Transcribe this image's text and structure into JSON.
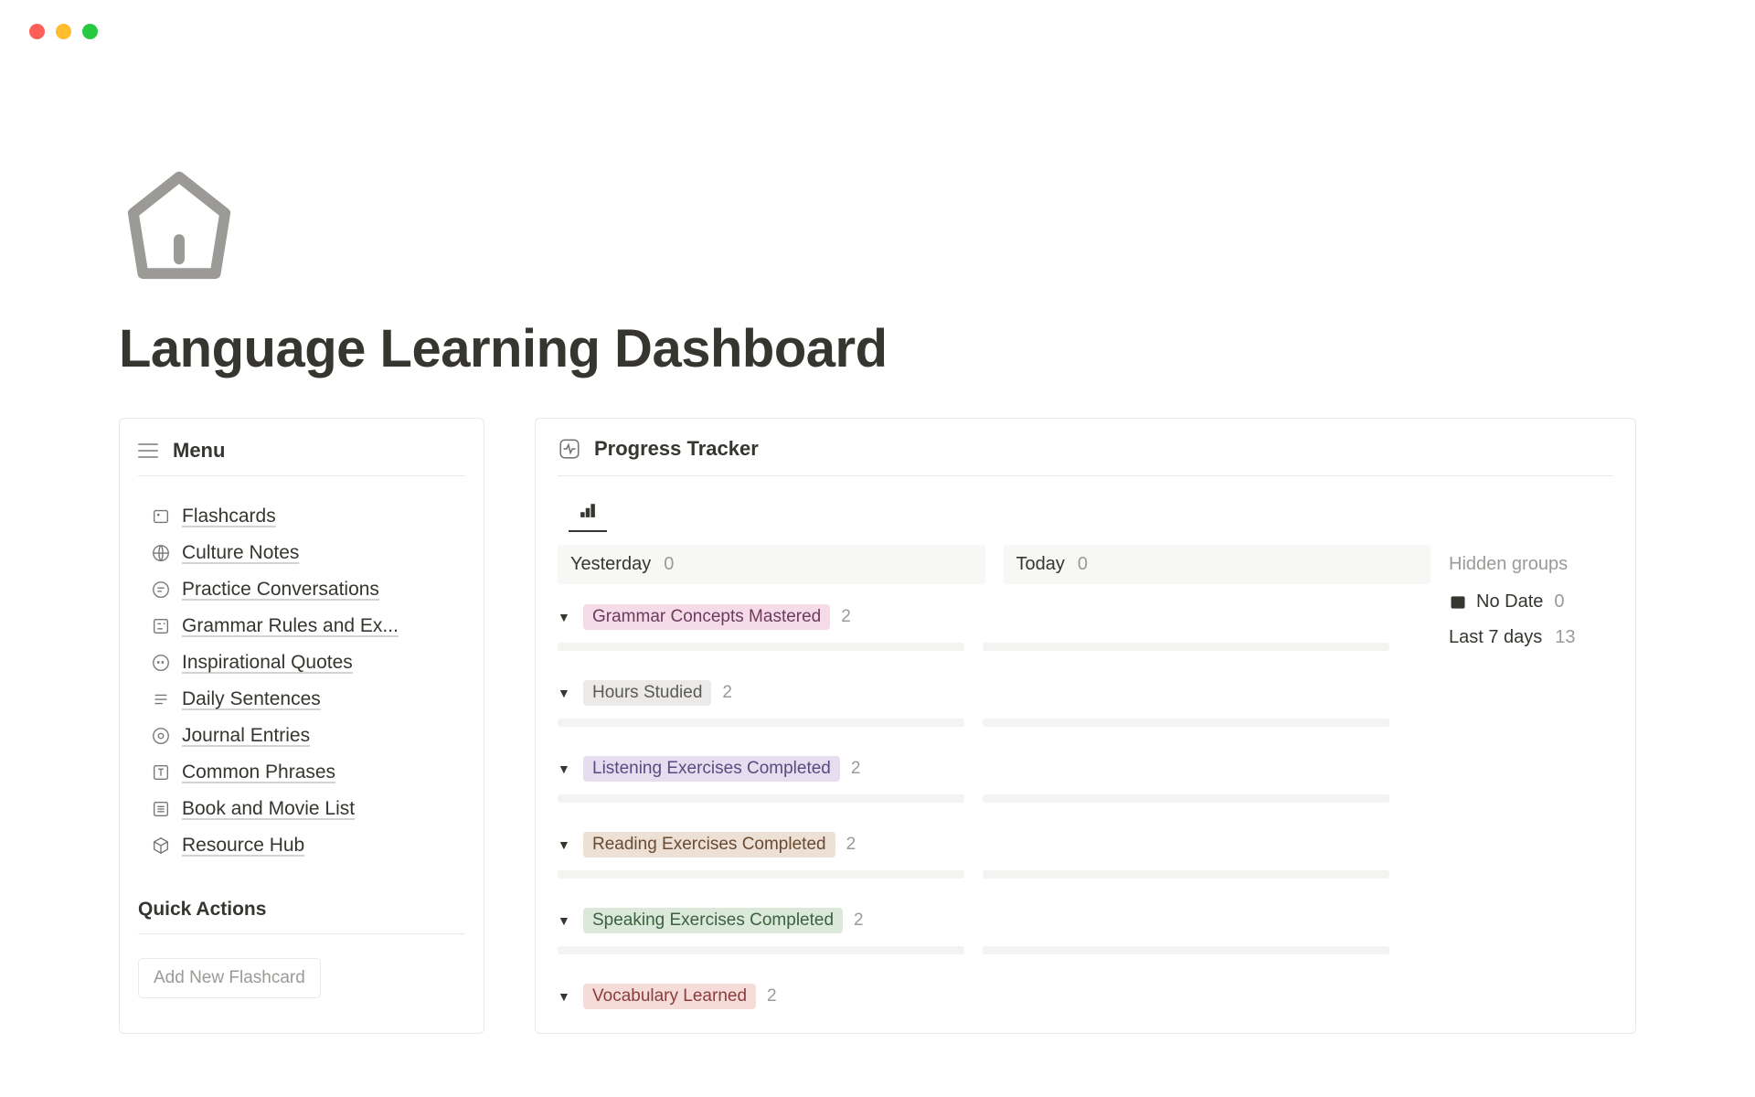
{
  "page": {
    "title": "Language Learning Dashboard"
  },
  "sidebar": {
    "title": "Menu",
    "items": [
      {
        "label": "Flashcards",
        "icon": "card"
      },
      {
        "label": "Culture Notes",
        "icon": "globe"
      },
      {
        "label": "Practice Conversations",
        "icon": "chat"
      },
      {
        "label": "Grammar Rules and Ex...",
        "icon": "grammar"
      },
      {
        "label": "Inspirational Quotes",
        "icon": "quote"
      },
      {
        "label": "Daily Sentences",
        "icon": "lines"
      },
      {
        "label": "Journal Entries",
        "icon": "journal"
      },
      {
        "label": "Common Phrases",
        "icon": "text"
      },
      {
        "label": "Book and Movie List",
        "icon": "list"
      },
      {
        "label": "Resource Hub",
        "icon": "cube"
      }
    ],
    "quick_actions_title": "Quick Actions",
    "quick_action_btn": "Add New Flashcard"
  },
  "panel": {
    "title": "Progress Tracker",
    "columns": [
      {
        "title": "Yesterday",
        "count": "0"
      },
      {
        "title": "Today",
        "count": "0"
      }
    ],
    "hidden_groups_label": "Hidden groups",
    "nodate": {
      "label": "No Date",
      "count": "0"
    },
    "last7": {
      "label": "Last 7 days",
      "count": "13"
    },
    "groups": [
      {
        "label": "Grammar Concepts Mastered",
        "count": "2",
        "color": "pink"
      },
      {
        "label": "Hours Studied",
        "count": "2",
        "color": "gray"
      },
      {
        "label": "Listening Exercises Completed",
        "count": "2",
        "color": "purple"
      },
      {
        "label": "Reading Exercises Completed",
        "count": "2",
        "color": "brown"
      },
      {
        "label": "Speaking Exercises Completed",
        "count": "2",
        "color": "green"
      },
      {
        "label": "Vocabulary Learned",
        "count": "2",
        "color": "red"
      }
    ]
  }
}
